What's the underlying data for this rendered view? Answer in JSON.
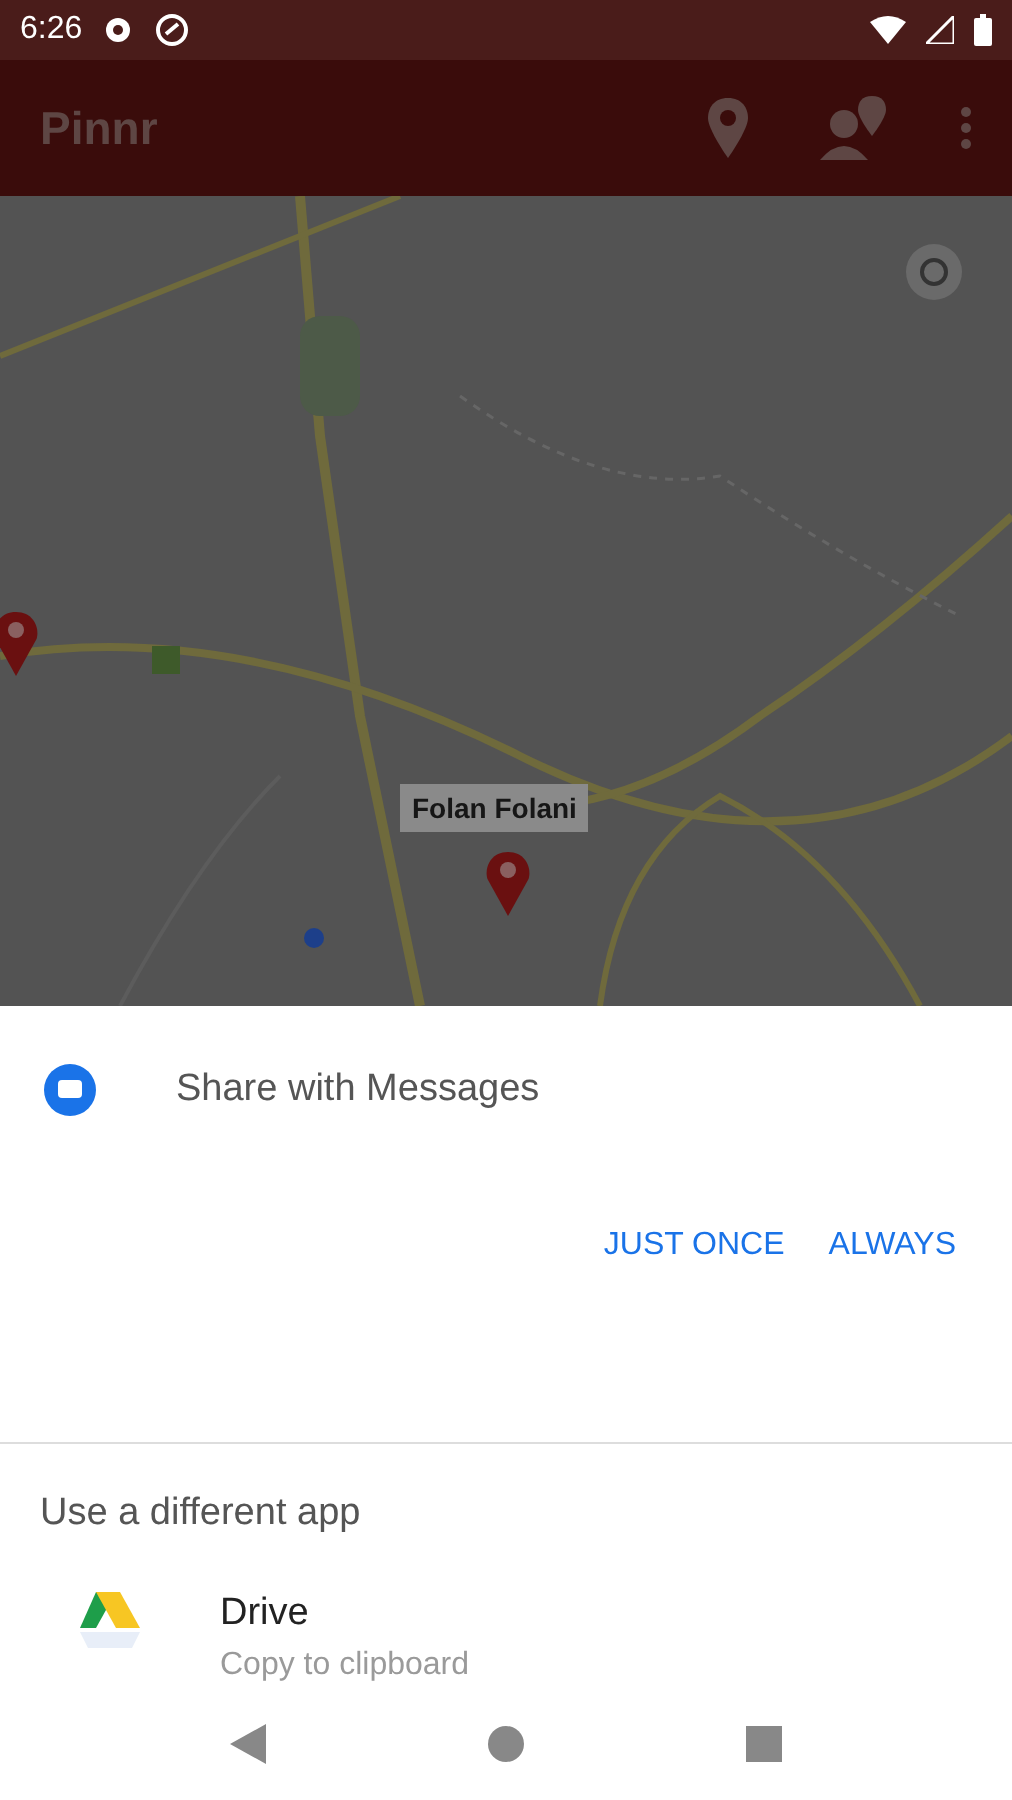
{
  "status_bar": {
    "time": "6:26"
  },
  "app_bar": {
    "title": "Pinnr"
  },
  "map": {
    "kind": "picture",
    "marker_label": "Folan Folani"
  },
  "share_sheet": {
    "title": "Share with Messages",
    "buttons": [
      "JUST ONCE",
      "ALWAYS"
    ],
    "section_title": "Use a different app",
    "apps": [
      {
        "name": "Drive",
        "subtitle": "Copy to clipboard"
      }
    ]
  }
}
